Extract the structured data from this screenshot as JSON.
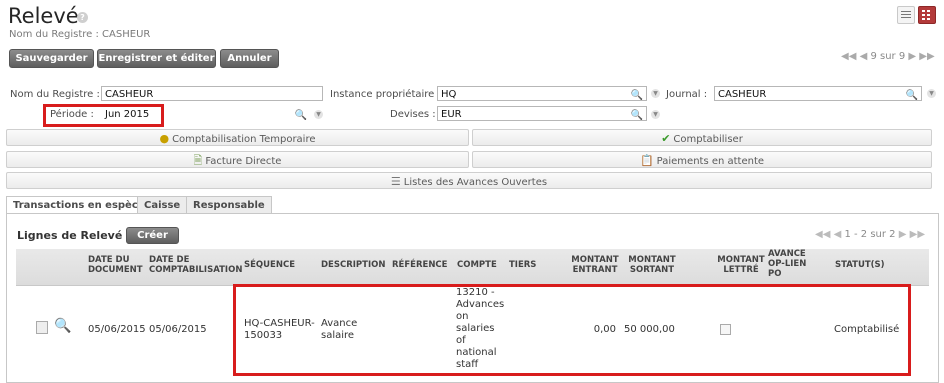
{
  "header": {
    "title": "Relevé",
    "help": "?",
    "subtitle": "Nom du Registre : CASHEUR"
  },
  "toolbar": {
    "save": "Sauvegarder",
    "save_edit": "Enregistrer et éditer",
    "cancel": "Annuler",
    "pager": "9 sur 9"
  },
  "form": {
    "registre_label": "Nom du Registre :",
    "registre_value": "CASHEUR",
    "instance_label": "Instance propriétaire :",
    "instance_value": "HQ",
    "journal_label": "Journal :",
    "journal_value": "CASHEUR",
    "periode_label": "Période :",
    "periode_value": "Jun 2015",
    "devises_label": "Devises :",
    "devises_value": "EUR"
  },
  "actions": {
    "compta_temp": "Comptabilisation Temporaire",
    "comptabiliser": "Comptabiliser",
    "facture_directe": "Facture Directe",
    "paiements_attente": "Paiements en attente",
    "listes_avances": "Listes des Avances Ouvertes"
  },
  "tabs": [
    "Transactions en espèce",
    "Caisse",
    "Responsable"
  ],
  "lines": {
    "title": "Lignes de Relevé",
    "create": "Créer",
    "pager": "1 - 2 sur 2",
    "columns": [
      "DATE DU DOCUMENT",
      "DATE DE COMPTABILISATION",
      "SÉQUENCE",
      "DESCRIPTION",
      "RÉFÉRENCE",
      "COMPTE",
      "TIERS",
      "MONTANT ENTRANT",
      "MONTANT SORTANT",
      "MONTANT LETTRÉ",
      "AVANCE OP-LIEN PO",
      "STATUT(S)"
    ],
    "row": {
      "date_doc": "05/06/2015",
      "date_compta": "05/06/2015",
      "sequence_1": "HQ-CASHEUR-",
      "sequence_2": "150033",
      "description_1": "Avance",
      "description_2": "salaire",
      "compte_lines": [
        "13210 -",
        "Advances",
        "on",
        "salaries",
        "of",
        "national",
        "staff"
      ],
      "entrant": "0,00",
      "sortant": "50 000,00",
      "statut": "Comptabilisé"
    }
  }
}
